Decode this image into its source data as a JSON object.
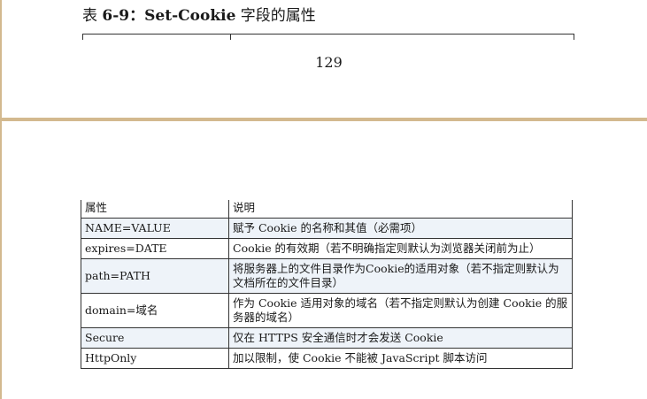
{
  "upper_page": {
    "caption": {
      "prefix": "表 ",
      "number": "6-9",
      "colon": "：",
      "field": "Set-Cookie",
      "suffix": " 字段的属性"
    },
    "page_number": "129"
  },
  "table": {
    "headers": [
      "属性",
      "说明"
    ],
    "rows": [
      {
        "attr": "NAME=VALUE",
        "desc": "赋予 Cookie 的名称和其值（必需项）"
      },
      {
        "attr": "expires=DATE",
        "desc": "Cookie 的有效期（若不明确指定则默认为浏览器关闭前为止）"
      },
      {
        "attr": "path=PATH",
        "desc": "将服务器上的文件目录作为Cookie的适用对象（若不指定则默认为文档所在的文件目录）"
      },
      {
        "attr": "domain=域名",
        "desc": "作为 Cookie 适用对象的域名（若不指定则默认为创建 Cookie 的服务器的域名）"
      },
      {
        "attr": "Secure",
        "desc": "仅在 HTTPS 安全通信时才会发送 Cookie"
      },
      {
        "attr": "HttpOnly",
        "desc": "加以限制，使 Cookie 不能被 JavaScript 脚本访问"
      }
    ]
  }
}
